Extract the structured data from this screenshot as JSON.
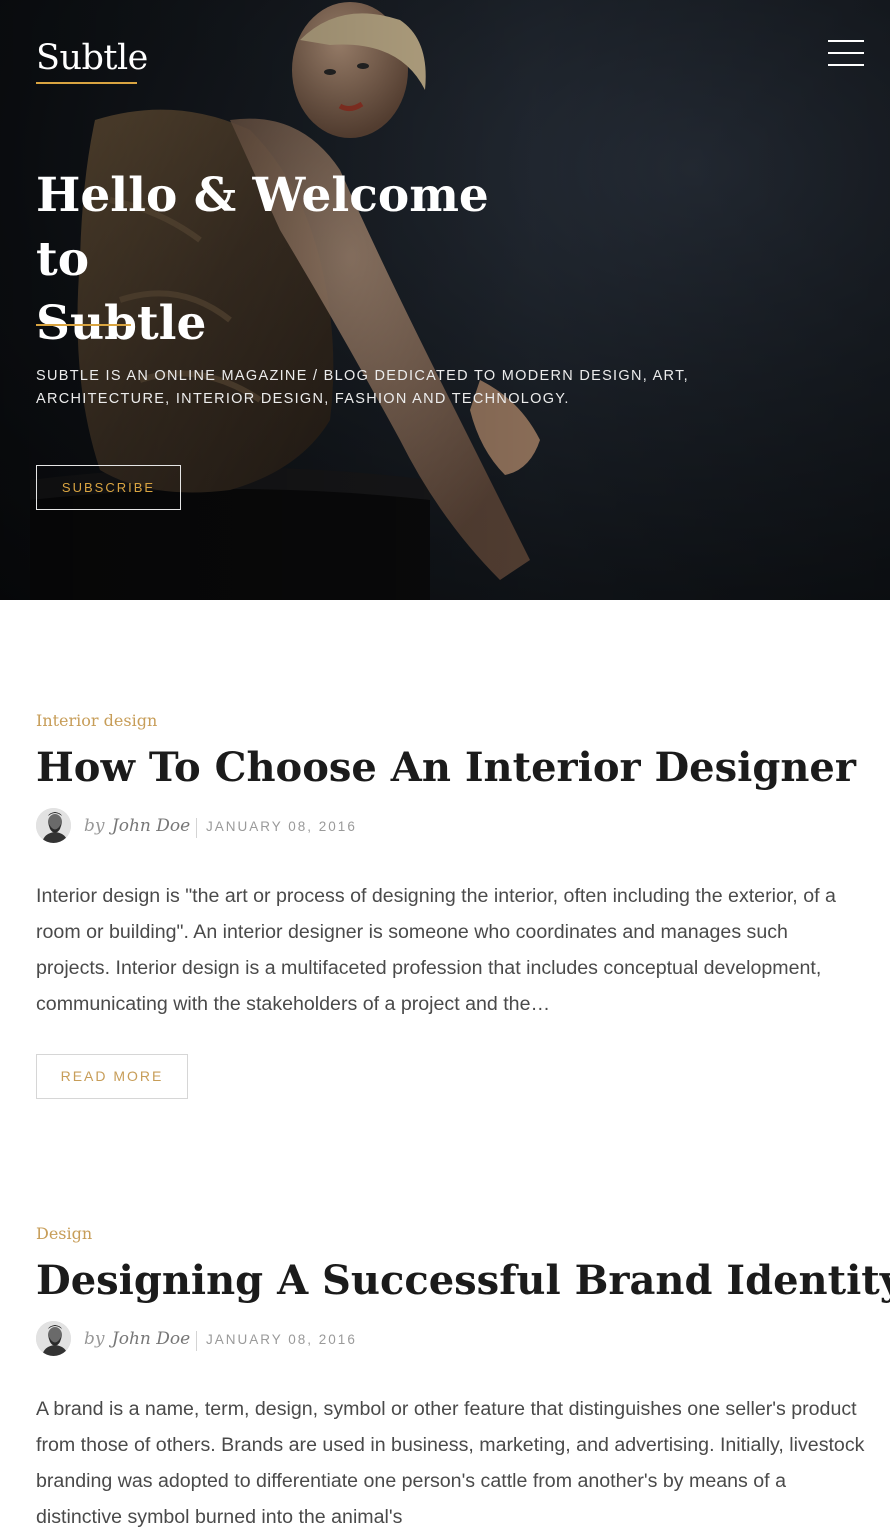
{
  "header": {
    "logo": "Subtle",
    "menu_icon": "hamburger-menu-icon"
  },
  "hero": {
    "title_line1": "Hello & Welcome to",
    "title_line2": "Subtle",
    "description": "Subtle is an online magazine / blog dedicated to modern design, art, architecture, interior design, fashion and technology.",
    "subscribe_label": "SUBSCRIBE"
  },
  "posts": [
    {
      "category": "Interior design",
      "title": "How To Choose An Interior Designer",
      "by": "by",
      "author": "John Doe",
      "date": "JANUARY 08, 2016",
      "excerpt": "Interior design is \"the art or process of designing the interior, often including the exterior, of a room or building\". An interior designer is someone who coordinates and manages such projects. Interior design is a multifaceted profession that includes conceptual development, communicating with the stakeholders of a project and the…",
      "read_more_label": "READ MORE"
    },
    {
      "category": "Design",
      "title": "Designing A Successful Brand Identity",
      "by": "by",
      "author": "John Doe",
      "date": "JANUARY 08, 2016",
      "excerpt": "A brand is a name, term, design, symbol or other feature that distinguishes one seller's product from those of others. Brands are used in business, marketing, and advertising. Initially, livestock branding was adopted to differentiate one person's cattle from another's by means of a distinctive symbol burned into the animal's"
    }
  ],
  "colors": {
    "accent": "#d9a441",
    "category": "#c79d58",
    "hero_background": "#12161b"
  }
}
